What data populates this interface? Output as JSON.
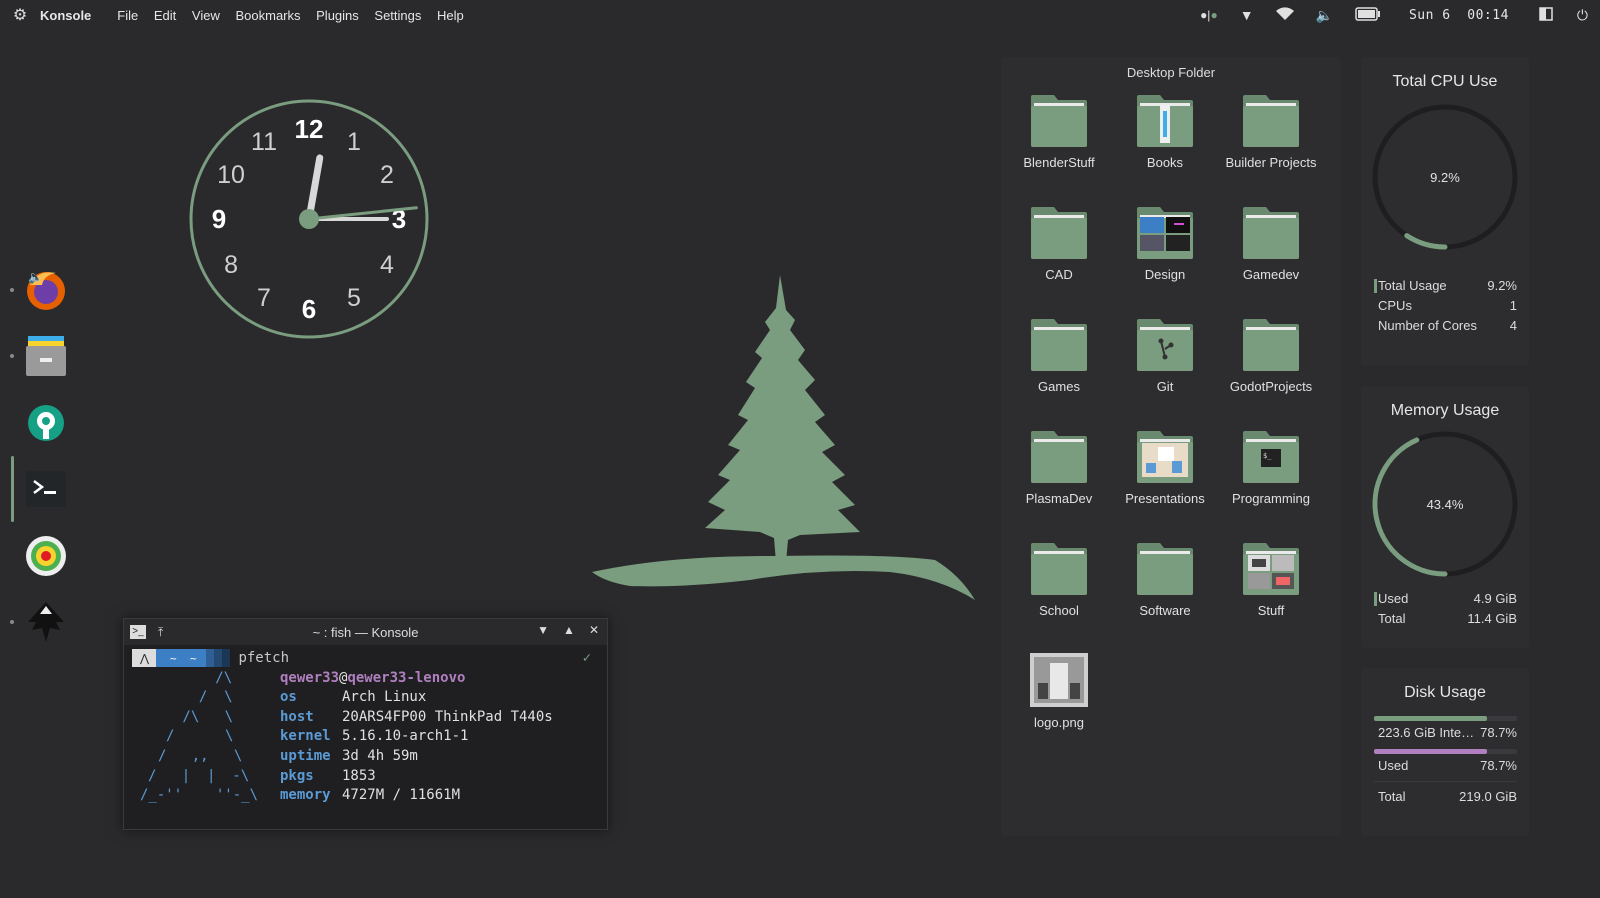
{
  "topbar": {
    "app_name": "Konsole",
    "menus": [
      "File",
      "Edit",
      "View",
      "Bookmarks",
      "Plugins",
      "Settings",
      "Help"
    ],
    "date": "Sun 6",
    "time": "00:14"
  },
  "clock": {
    "numbers": [
      "12",
      "1",
      "2",
      "3",
      "4",
      "5",
      "6",
      "7",
      "8",
      "9",
      "10",
      "11"
    ],
    "hour": 0,
    "minute": 14
  },
  "desktop_folder": {
    "title": "Desktop Folder",
    "items": [
      {
        "label": "BlenderStuff",
        "icon": "folder-icon"
      },
      {
        "label": "Books",
        "icon": "folder-books-icon"
      },
      {
        "label": "Builder Projects",
        "icon": "folder-icon"
      },
      {
        "label": "CAD",
        "icon": "folder-icon"
      },
      {
        "label": "Design",
        "icon": "folder-design-icon"
      },
      {
        "label": "Gamedev",
        "icon": "folder-icon"
      },
      {
        "label": "Games",
        "icon": "folder-icon"
      },
      {
        "label": "Git",
        "icon": "folder-git-icon"
      },
      {
        "label": "GodotProjects",
        "icon": "folder-icon"
      },
      {
        "label": "PlasmaDev",
        "icon": "folder-icon"
      },
      {
        "label": "Presentations",
        "icon": "folder-presentations-icon"
      },
      {
        "label": "Programming",
        "icon": "folder-terminal-icon"
      },
      {
        "label": "School",
        "icon": "folder-icon"
      },
      {
        "label": "Software",
        "icon": "folder-icon"
      },
      {
        "label": "Stuff",
        "icon": "folder-stuff-icon"
      },
      {
        "label": "logo.png",
        "icon": "image-file-icon"
      }
    ]
  },
  "cpu": {
    "title": "Total CPU Use",
    "percent_label": "9.2%",
    "value": 9.2,
    "rows": [
      {
        "k": "Total Usage",
        "v": "9.2%"
      },
      {
        "k": "CPUs",
        "v": "1"
      },
      {
        "k": "Number of Cores",
        "v": "4"
      }
    ]
  },
  "memory": {
    "title": "Memory Usage",
    "percent_label": "43.4%",
    "value": 43.4,
    "rows": [
      {
        "k": "Used",
        "v": "4.9 GiB"
      },
      {
        "k": "Total",
        "v": "11.4 GiB"
      }
    ]
  },
  "disk": {
    "title": "Disk Usage",
    "rows": [
      {
        "k": "223.6 GiB Inte…",
        "v": "78.7%"
      },
      {
        "k": "Used",
        "v": "78.7%"
      },
      {
        "k": "Total",
        "v": "219.0 GiB"
      }
    ],
    "fill": 0.787
  },
  "konsole": {
    "title": "~ : fish — Konsole",
    "prompt_path": "~",
    "command": "pfetch",
    "check": "✓",
    "user": "qewer33",
    "host_name": "qewer33-lenovo",
    "logo": [
      "   /\\",
      "  /  \\",
      " /\\   \\",
      "/      \\",
      "/   ,,   \\",
      "/   |  |  -\\",
      "/_-''    ''-_\\"
    ],
    "info": [
      {
        "k": "os",
        "v": "Arch Linux"
      },
      {
        "k": "host",
        "v": "20ARS4FP00 ThinkPad T440s"
      },
      {
        "k": "kernel",
        "v": "5.16.10-arch1-1"
      },
      {
        "k": "uptime",
        "v": "3d 4h 59m"
      },
      {
        "k": "pkgs",
        "v": "1853"
      },
      {
        "k": "memory",
        "v": "4727M / 11661M"
      }
    ]
  },
  "colors": {
    "accent": "#7a9c7f",
    "folder": "#7a9c7f",
    "memory_bar": "#7a9c7f",
    "disk_used_bar": "#b07fbf"
  }
}
